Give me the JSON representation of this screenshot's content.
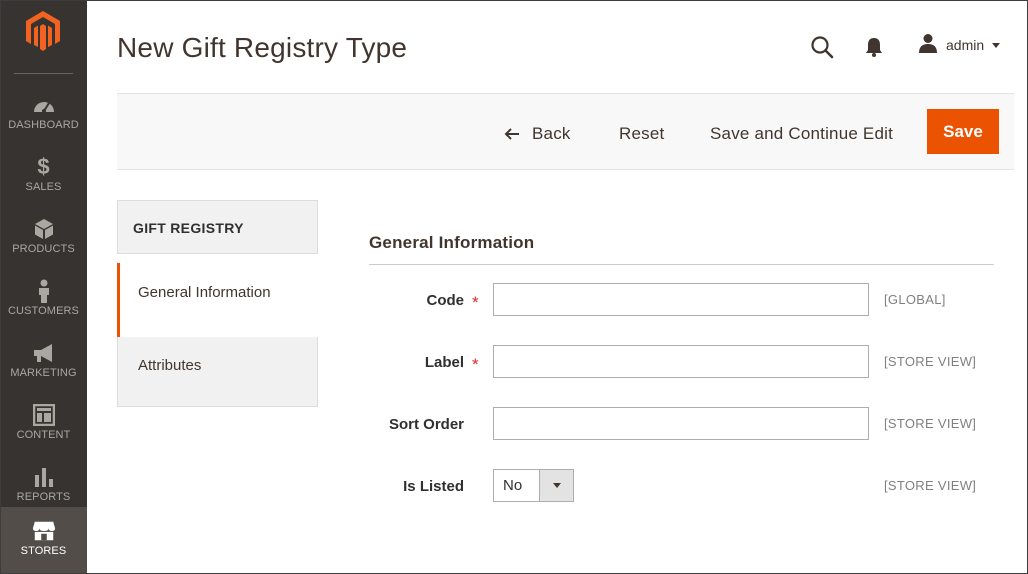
{
  "page": {
    "title": "New Gift Registry Type"
  },
  "header": {
    "user_name": "admin"
  },
  "sidebar": {
    "items": [
      {
        "label": "DASHBOARD",
        "icon": "dashboard-icon",
        "active": false
      },
      {
        "label": "SALES",
        "icon": "dollar-icon",
        "active": false
      },
      {
        "label": "PRODUCTS",
        "icon": "cube-icon",
        "active": false
      },
      {
        "label": "CUSTOMERS",
        "icon": "person-icon",
        "active": false
      },
      {
        "label": "MARKETING",
        "icon": "megaphone-icon",
        "active": false
      },
      {
        "label": "CONTENT",
        "icon": "layout-icon",
        "active": false
      },
      {
        "label": "REPORTS",
        "icon": "bar-chart-icon",
        "active": false
      },
      {
        "label": "STORES",
        "icon": "store-icon",
        "active": true
      }
    ]
  },
  "actions": {
    "back": "Back",
    "reset": "Reset",
    "save_continue": "Save and Continue Edit",
    "save": "Save"
  },
  "tabs": {
    "title": "GIFT REGISTRY",
    "items": [
      {
        "label": "General Information",
        "active": true
      },
      {
        "label": "Attributes",
        "active": false
      }
    ]
  },
  "form": {
    "section_title": "General Information",
    "fields": [
      {
        "label": "Code",
        "required": true,
        "value": "",
        "scope": "[GLOBAL]"
      },
      {
        "label": "Label",
        "required": true,
        "value": "",
        "scope": "[STORE VIEW]"
      },
      {
        "label": "Sort Order",
        "required": false,
        "value": "",
        "scope": "[STORE VIEW]"
      },
      {
        "label": "Is Listed",
        "required": false,
        "value": "No",
        "scope": "[STORE VIEW]"
      }
    ],
    "required_mark": "*"
  },
  "colors": {
    "sidebar": "#373330",
    "sidebar_active": "#524d49",
    "accent": "#eb5202",
    "logo": "#f26322"
  }
}
